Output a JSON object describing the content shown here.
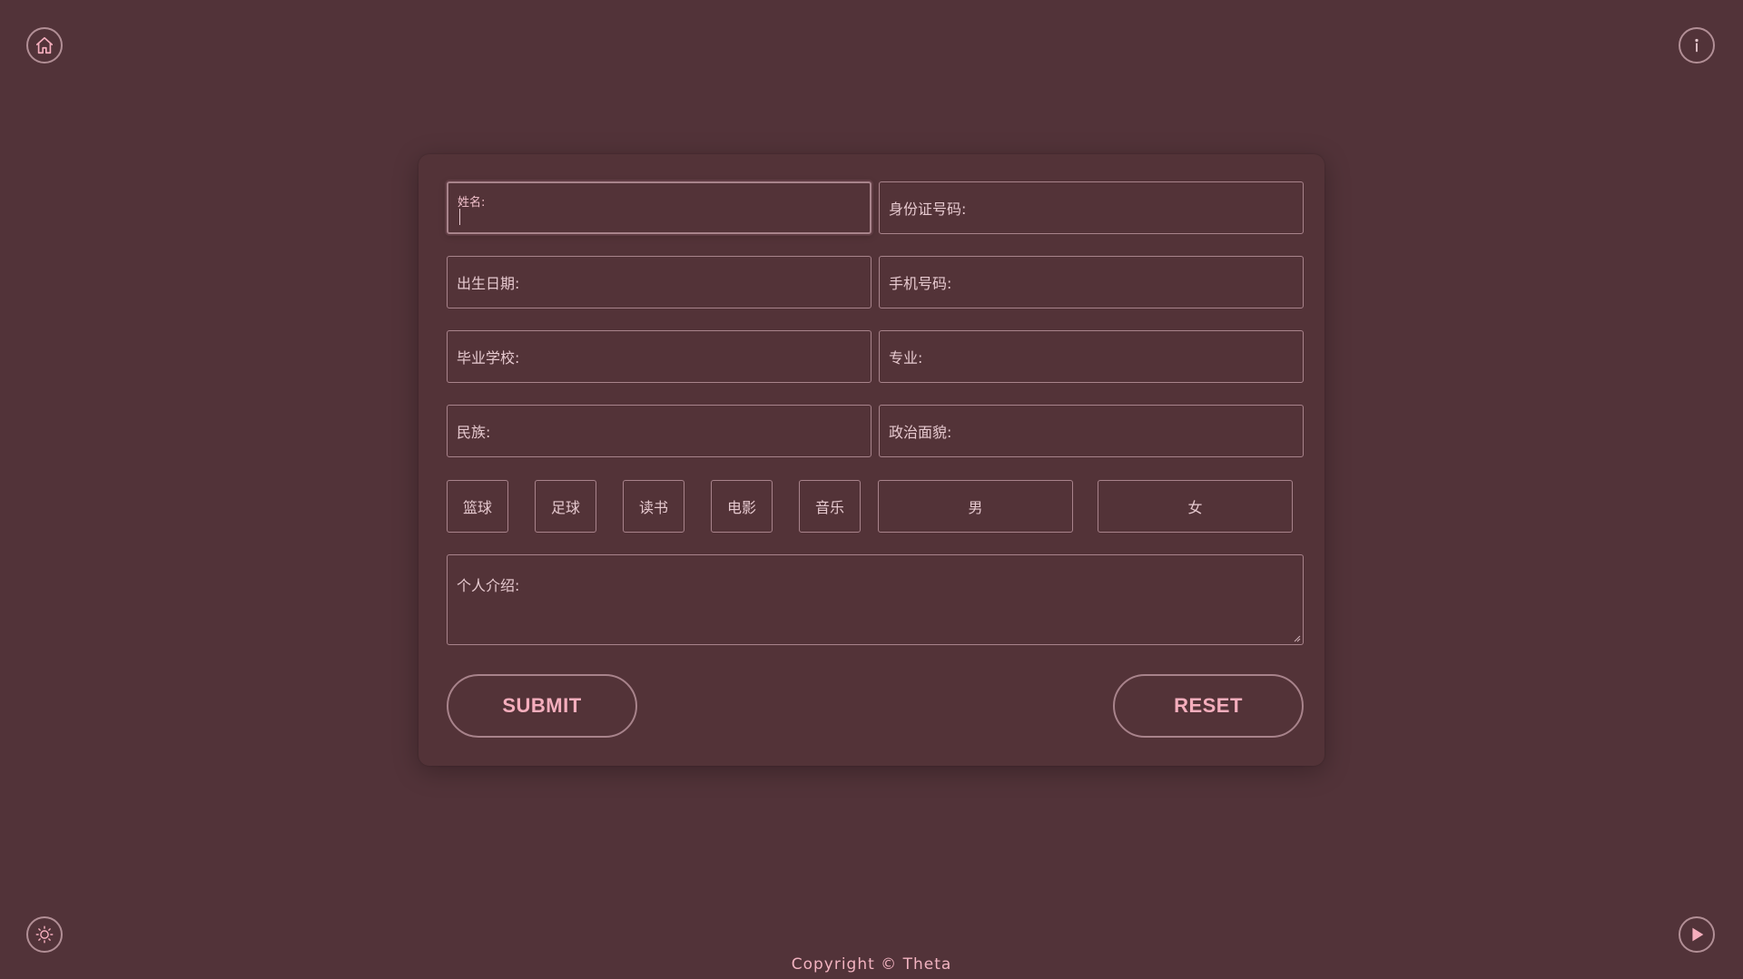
{
  "colors": {
    "background": "#523339",
    "card": "#533338",
    "border": "#a8838b",
    "text": "#e6c9cf",
    "accent": "#f5aebd"
  },
  "corner_buttons": {
    "home": {
      "icon": "home-icon"
    },
    "info": {
      "icon": "info-icon"
    },
    "theme": {
      "icon": "sun-icon"
    },
    "play": {
      "icon": "play-icon"
    }
  },
  "form": {
    "fields": {
      "name": {
        "label": "姓名:",
        "value": ""
      },
      "id_number": {
        "label": "身份证号码:",
        "value": ""
      },
      "birth_date": {
        "label": "出生日期:",
        "value": ""
      },
      "phone": {
        "label": "手机号码:",
        "value": ""
      },
      "school": {
        "label": "毕业学校:",
        "value": ""
      },
      "major": {
        "label": "专业:",
        "value": ""
      },
      "ethnicity": {
        "label": "民族:",
        "value": ""
      },
      "political_status": {
        "label": "政治面貌:",
        "value": ""
      }
    },
    "hobbies": [
      "篮球",
      "足球",
      "读书",
      "电影",
      "音乐"
    ],
    "genders": [
      "男",
      "女"
    ],
    "intro": {
      "label": "个人介绍:",
      "value": ""
    },
    "submit_label": "SUBMIT",
    "reset_label": "RESET"
  },
  "footer": {
    "copyright": "Copyright © Theta"
  }
}
